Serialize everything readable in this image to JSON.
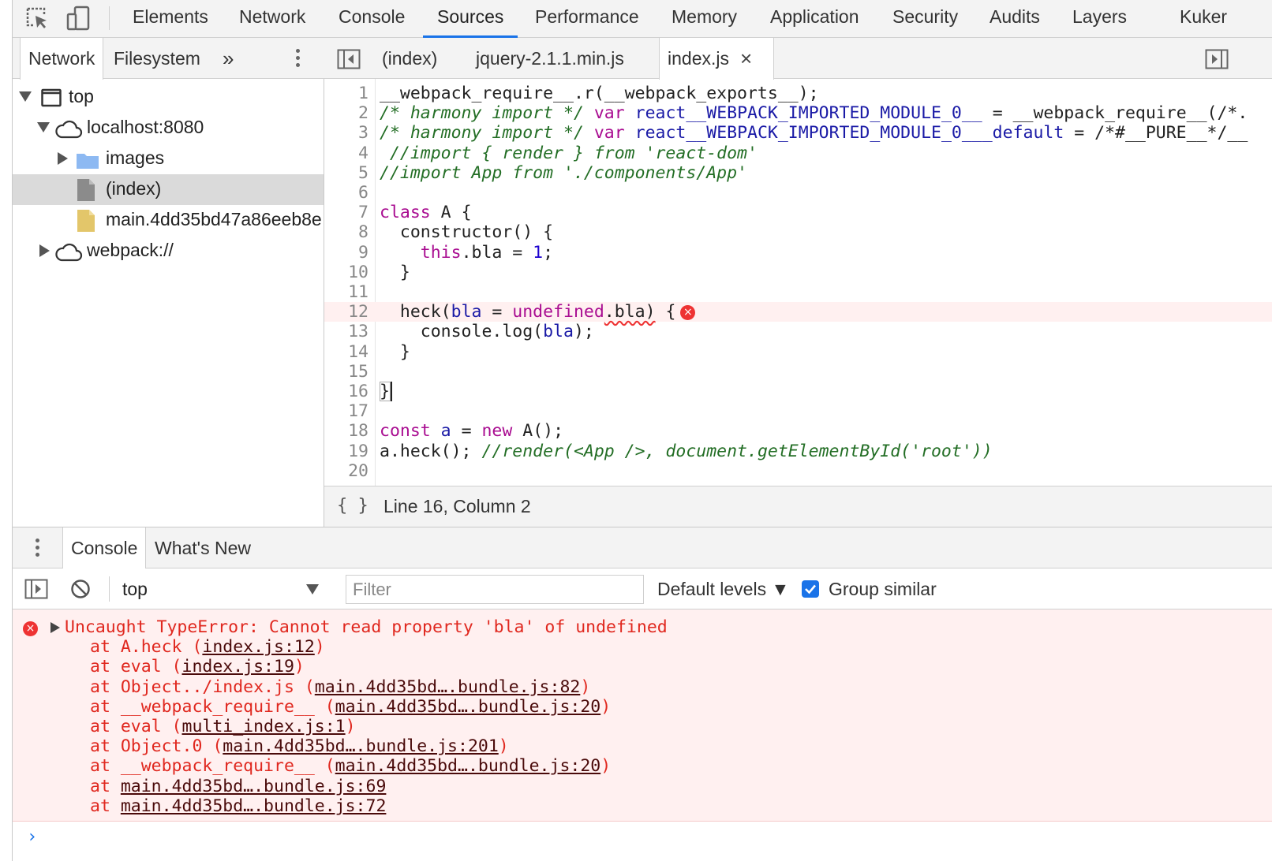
{
  "main_tabs": [
    "Elements",
    "Network",
    "Console",
    "Sources",
    "Performance",
    "Memory",
    "Application",
    "Security",
    "Audits",
    "Layers",
    "Kuker"
  ],
  "navigator": {
    "tabs": [
      "Network",
      "Filesystem"
    ],
    "more": "»",
    "tree": [
      "top",
      "localhost:8080",
      "images",
      "(index)",
      "main.4dd35bd47a86eeb8e",
      "webpack://"
    ]
  },
  "editor": {
    "tabs": [
      "(index)",
      "jquery-2.1.1.min.js",
      "index.js"
    ],
    "close": "×",
    "line_numbers": [
      "1",
      "2",
      "3",
      "4",
      "5",
      "6",
      "7",
      "8",
      "9",
      "10",
      "11",
      "12",
      "13",
      "14",
      "15",
      "16",
      "17",
      "18",
      "19",
      "20"
    ],
    "code": {
      "l1": "__webpack_require__.r(__webpack_exports__);",
      "l2_comment": "/* harmony import */",
      "l2_var": "var",
      "l2_name": "react__WEBPACK_IMPORTED_MODULE_0__",
      "l2_rest": " = __webpack_require__(/*.",
      "l3_comment": "/* harmony import */",
      "l3_var": "var",
      "l3_name": "react__WEBPACK_IMPORTED_MODULE_0___default",
      "l3_rest": " = /*#__PURE__*/__",
      "l4": " //import { render } from 'react-dom'",
      "l5": "//import App from './components/App'",
      "l7_kw": "class",
      "l7_rest": " A {",
      "l8": "  constructor() {",
      "l9_this": "this",
      "l9_rest": ".bla = ",
      "l9_num": "1",
      "l9_end": ";",
      "l10": "  }",
      "l12_start": "  heck(",
      "l12_param": "bla",
      "l12_eq": " = ",
      "l12_undef": "undefined",
      "l12_dot": ".bla)",
      "l12_end": " {",
      "l13_a": "    console.log(",
      "l13_b": "bla",
      "l13_c": ");",
      "l14": "  }",
      "l16": "}",
      "l18_const": "const",
      "l18_a": " a",
      "l18_eq": " = ",
      "l18_new": "new",
      "l18_rest": " A();",
      "l19_a": "a.heck(); ",
      "l19_comment": "//render(<App />, document.getElementById('root'))"
    },
    "error_badge": "×",
    "pretty_print": "{ }",
    "status": "Line 16, Column 2"
  },
  "drawer": {
    "tabs": [
      "Console",
      "What's New"
    ],
    "context": "top",
    "filter_placeholder": "Filter",
    "levels": "Default levels ▼",
    "group_similar": "Group similar",
    "group_similar_checked": true,
    "error": {
      "message": "Uncaught TypeError: Cannot read property 'bla' of undefined",
      "stack": [
        {
          "prefix": "at A.heck (",
          "link": "index.js:12",
          "suffix": ")"
        },
        {
          "prefix": "at eval (",
          "link": "index.js:19",
          "suffix": ")"
        },
        {
          "prefix": "at Object../index.js (",
          "link": "main.4dd35bd….bundle.js:82",
          "suffix": ")"
        },
        {
          "prefix": "at __webpack_require__ (",
          "link": "main.4dd35bd….bundle.js:20",
          "suffix": ")"
        },
        {
          "prefix": "at eval (",
          "link": "multi_index.js:1",
          "suffix": ")"
        },
        {
          "prefix": "at Object.0 (",
          "link": "main.4dd35bd….bundle.js:201",
          "suffix": ")"
        },
        {
          "prefix": "at __webpack_require__ (",
          "link": "main.4dd35bd….bundle.js:20",
          "suffix": ")"
        },
        {
          "prefix": "at ",
          "link": "main.4dd35bd….bundle.js:69",
          "suffix": ""
        },
        {
          "prefix": "at ",
          "link": "main.4dd35bd….bundle.js:72",
          "suffix": ""
        }
      ]
    },
    "prompt": "›"
  },
  "colors": {
    "accent": "#1a73e8",
    "error_text": "#e0281f",
    "error_bg": "#fff0f0",
    "keyword": "#a90d91",
    "comment": "#236e25",
    "variable": "#1a1aa6"
  }
}
